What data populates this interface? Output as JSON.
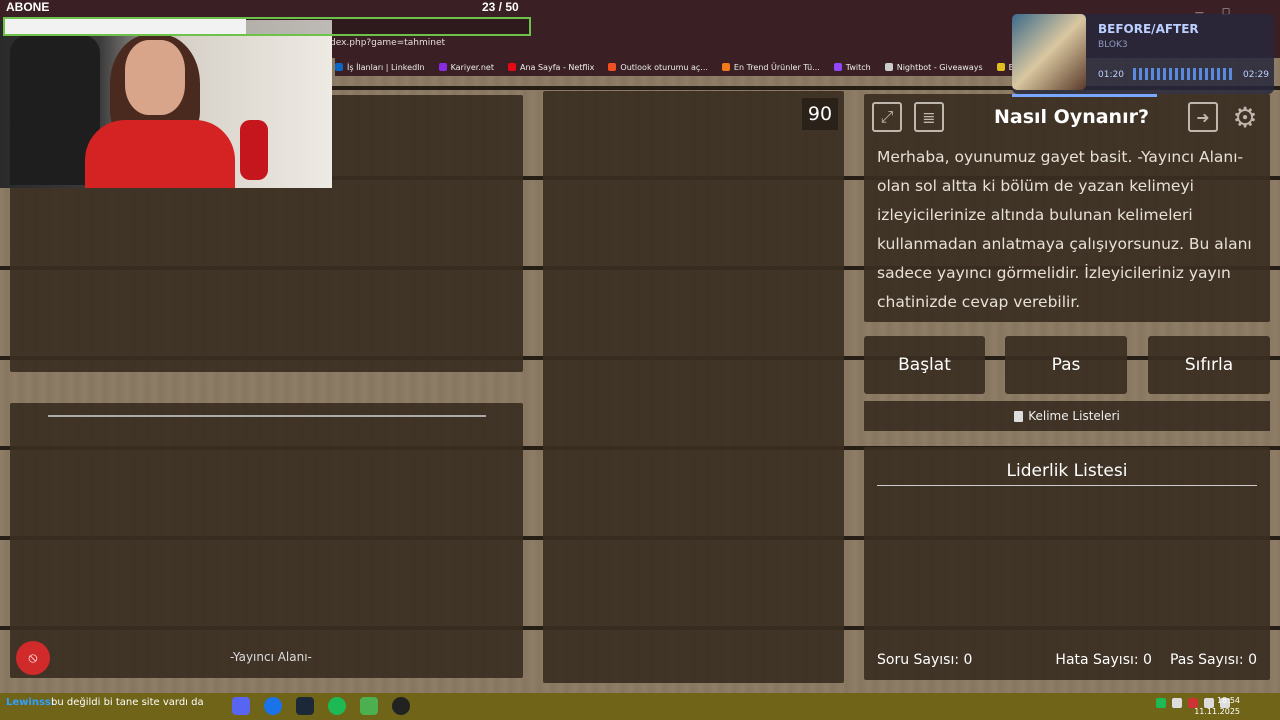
{
  "overlay": {
    "sub_label": "ABONE",
    "sub_count": "23  / 50",
    "sub_progress_pct": 46
  },
  "browser": {
    "url_fragment": "dex.php?game=tahminet",
    "bookmarks": [
      {
        "label": "İş İlanları | LinkedIn",
        "color": "#0a66c2"
      },
      {
        "label": "Kariyer.net",
        "color": "#8a2be2"
      },
      {
        "label": "Ana Sayfa - Netflix",
        "color": "#e50914"
      },
      {
        "label": "Outlook oturumu aç...",
        "color": "#f25022"
      },
      {
        "label": "En Trend Ürünler Tü...",
        "color": "#f27a1a"
      },
      {
        "label": "Twitch",
        "color": "#9146ff"
      },
      {
        "label": "Nightbot - Giveaways",
        "color": "#cccccc"
      },
      {
        "label": "ByNoDeck il",
        "color": "#e0c020"
      }
    ]
  },
  "music": {
    "title": "BEFORE/AFTER",
    "artist": "BLOK3",
    "elapsed": "01:20",
    "duration": "02:29"
  },
  "game": {
    "timer": "90",
    "streamer_area_label": "-Yayıncı Alanı-",
    "howto_title": "Nasıl Oynanır?",
    "howto_text": "Merhaba, oyunumuz gayet basit. -Yayıncı Alanı- olan sol altta ki bölüm de yazan kelimeyi izleyicilerinize altında bulunan kelimeleri kullanmadan anlatmaya çalışıyorsunuz. Bu alanı sadece yayıncı görmelidir. İzleyicileriniz yayın chatinizde cevap verebilir.",
    "buttons": {
      "start": "Başlat",
      "pass": "Pas",
      "reset": "Sıfırla"
    },
    "word_lists": "Kelime Listeleri",
    "leaderboard_title": "Liderlik Listesi",
    "stats": {
      "questions": "Soru Sayısı: 0",
      "errors": "Hata Sayısı: 0",
      "passes": "Pas Sayısı: 0"
    }
  },
  "chat": {
    "user": "Lewinss:",
    "message": "bu değildi bi tane site vardı da"
  },
  "clock": {
    "time": "18:54",
    "date": "11.11.2025"
  }
}
